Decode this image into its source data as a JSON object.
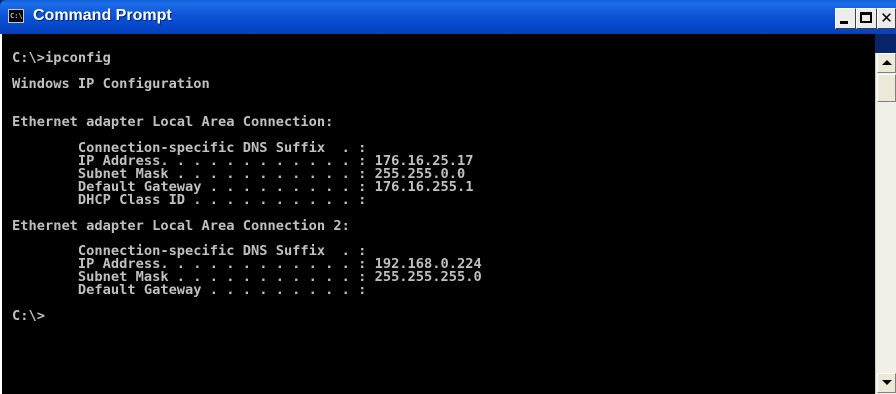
{
  "window": {
    "title": "Command Prompt",
    "icon_label": "C:\\",
    "minimize_icon": "minimize-icon",
    "maximize_icon": "maximize-icon",
    "close_icon": "close-icon",
    "close_glyph": "✕",
    "title_bar_color": "#0a5fd8"
  },
  "console": {
    "background_color": "#000000",
    "text_color": "#c0c0c0",
    "lines": [
      "C:\\>ipconfig",
      "",
      "Windows IP Configuration",
      "",
      "",
      "Ethernet adapter Local Area Connection:",
      "",
      "        Connection-specific DNS Suffix  . :",
      "        IP Address. . . . . . . . . . . . : 176.16.25.17",
      "        Subnet Mask . . . . . . . . . . . : 255.255.0.0",
      "        Default Gateway . . . . . . . . . : 176.16.255.1",
      "        DHCP Class ID . . . . . . . . . . :",
      "",
      "Ethernet adapter Local Area Connection 2:",
      "",
      "        Connection-specific DNS Suffix  . :",
      "        IP Address. . . . . . . . . . . . : 192.168.0.224",
      "        Subnet Mask . . . . . . . . . . . : 255.255.255.0",
      "        Default Gateway . . . . . . . . . :",
      "",
      "C:\\>"
    ]
  },
  "scrollbar": {
    "up_icon": "arrow-up-icon",
    "down_icon": "arrow-down-icon",
    "position": 0
  }
}
